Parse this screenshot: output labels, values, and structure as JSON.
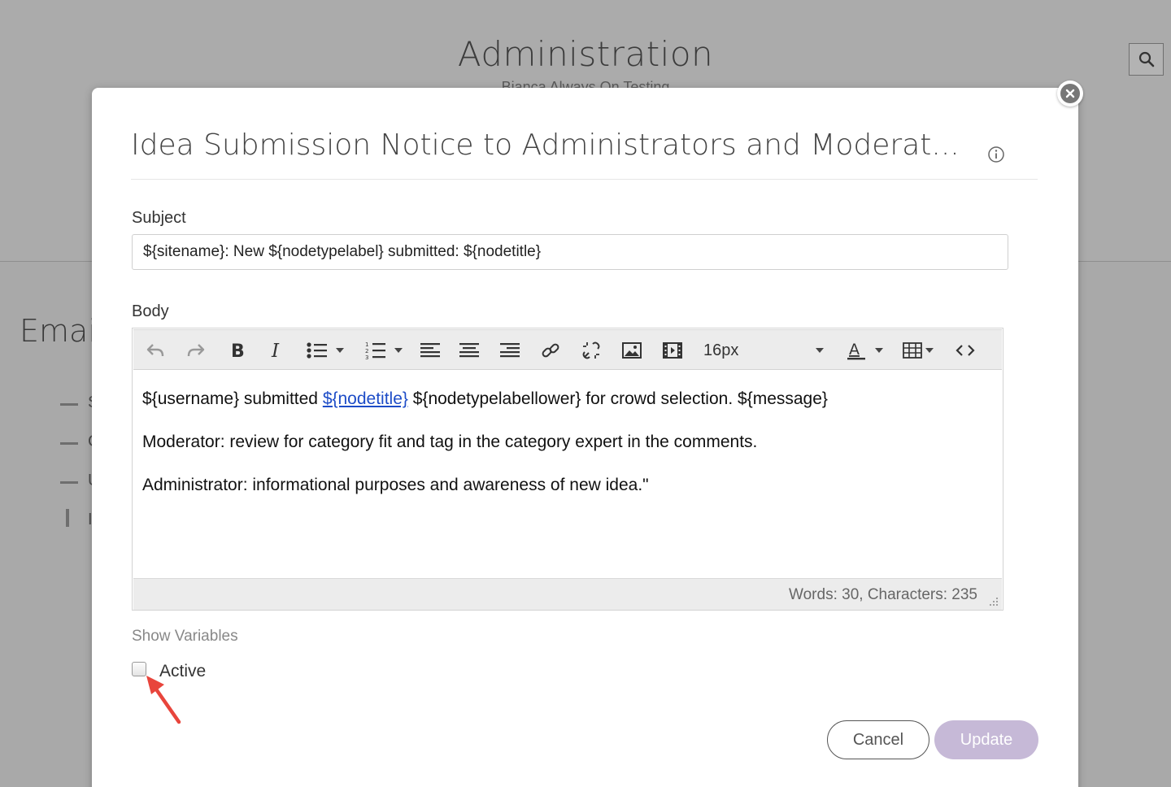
{
  "background": {
    "title": "Administration",
    "subtitle": "Bianca Always On Testing",
    "section_title": "Emai",
    "list_letters": [
      "S",
      "C",
      "U",
      "I"
    ]
  },
  "modal": {
    "title": "Idea Submission Notice to Administrators and Moderat...",
    "subject_label": "Subject",
    "subject_value": "${sitename}: New ${nodetypelabel} submitted: ${nodetitle}",
    "body_label": "Body",
    "toolbar": {
      "font_size": "16px"
    },
    "body": {
      "line1_pre": "${username} submitted ",
      "line1_link": "${nodetitle}",
      "line1_post": " ${nodetypelabellower} for crowd selection. ${message}",
      "line2": "Moderator: review for category fit and tag in the category expert in the comments.",
      "line3": "Administrator: informational purposes and awareness of new idea.\""
    },
    "word_count": "Words: 30, Characters: 235",
    "show_variables": "Show Variables",
    "active_label": "Active",
    "active_checked": false,
    "cancel_label": "Cancel",
    "update_label": "Update"
  },
  "colors": {
    "overlay": "#ababab",
    "update_button": "#c6b9d7",
    "link": "#1d4cc7",
    "annotation_arrow": "#e8453c"
  }
}
